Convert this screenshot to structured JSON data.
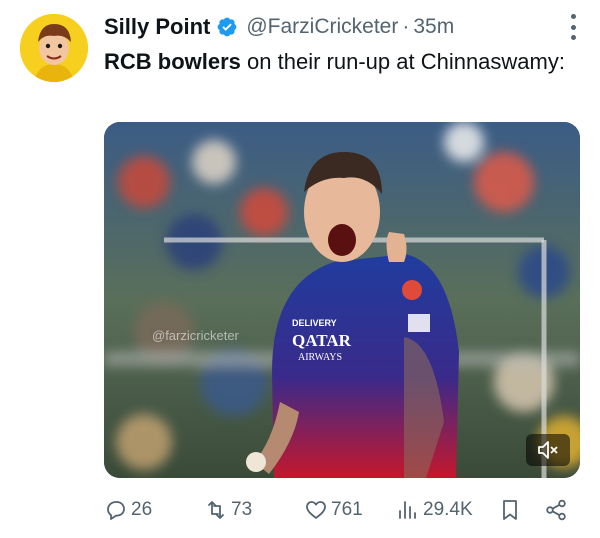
{
  "author": {
    "name": "Silly Point",
    "handle": "@FarziCricketer",
    "separator": "·",
    "time": "35m"
  },
  "tweet": {
    "text_bold": "RCB bowlers",
    "text_rest": " on their run-up at Chinnaswamy:"
  },
  "media": {
    "watermark": "@farzicricketer",
    "jersey_sponsor": "QATAR",
    "jersey_sponsor_sub": "AIRWAYS"
  },
  "actions": {
    "replies": "26",
    "reposts": "73",
    "likes": "761",
    "views": "29.4K"
  },
  "colors": {
    "verified": "#1d9bf0",
    "muted_text": "#536471",
    "jersey_blue": "#1f3d9e",
    "jersey_red": "#c4182c"
  },
  "icons": [
    "verified-icon",
    "more-icon",
    "mute-icon",
    "reply-icon",
    "repost-icon",
    "like-icon",
    "views-icon",
    "bookmark-icon",
    "share-icon"
  ]
}
